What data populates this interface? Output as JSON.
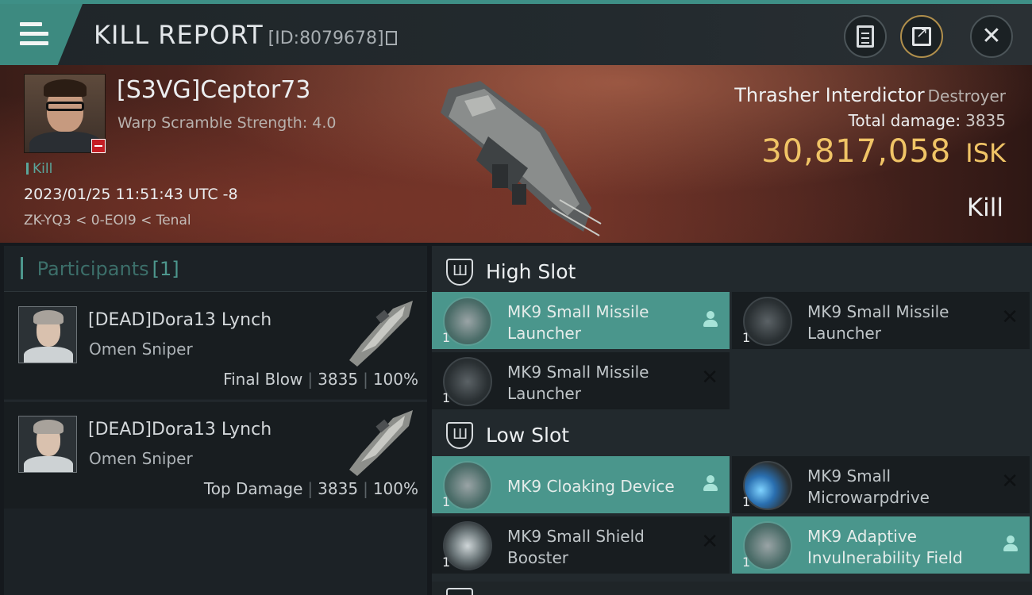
{
  "header": {
    "title": "KILL REPORT",
    "report_id": "[ID:8079678]",
    "icons": [
      "menu-icon",
      "document-icon",
      "share-icon",
      "close-icon"
    ]
  },
  "victim": {
    "name": "[S3VG]Ceptor73",
    "subtitle": "Warp Scramble Strength: 4.0",
    "tag": "Kill",
    "datetime": "2023/01/25 11:51:43 UTC -8",
    "location": "ZK-YQ3 < 0-EOI9 < Tenal"
  },
  "ship": {
    "name": "Thrasher Interdictor",
    "class": "Destroyer",
    "total_damage_label": "Total damage:",
    "total_damage": "3835",
    "isk_value": "30,817,058",
    "isk_unit": "ISK",
    "result": "Kill"
  },
  "participants": {
    "title": "Participants",
    "count": "[1]",
    "rows": [
      {
        "name": "[DEAD]Dora13 Lynch",
        "ship": "Omen Sniper",
        "role": "Final Blow",
        "damage": "3835",
        "percent": "100%"
      },
      {
        "name": "[DEAD]Dora13 Lynch",
        "ship": "Omen Sniper",
        "role": "Top Damage",
        "damage": "3835",
        "percent": "100%"
      }
    ]
  },
  "slots": {
    "high": {
      "title": "High Slot",
      "modules": [
        {
          "name": "MK9 Small Missile Launcher",
          "qty": "1",
          "status": "dropped"
        },
        {
          "name": "MK9 Small Missile Launcher",
          "qty": "1",
          "status": "destroyed"
        },
        {
          "name": "MK9 Small Missile Launcher",
          "qty": "1",
          "status": "destroyed"
        }
      ]
    },
    "low": {
      "title": "Low Slot",
      "modules": [
        {
          "name": "MK9 Cloaking Device",
          "qty": "1",
          "status": "dropped"
        },
        {
          "name": "MK9 Small Microwarpdrive",
          "qty": "1",
          "status": "destroyed"
        },
        {
          "name": "MK9 Small Shield Booster",
          "qty": "1",
          "status": "destroyed"
        },
        {
          "name": "MK9 Adaptive Invulnerability Field",
          "qty": "1",
          "status": "dropped"
        }
      ]
    }
  },
  "colors": {
    "accent_teal": "#4a968c",
    "isk_gold": "#f0c466",
    "kill_badge_red": "#c41e24"
  }
}
